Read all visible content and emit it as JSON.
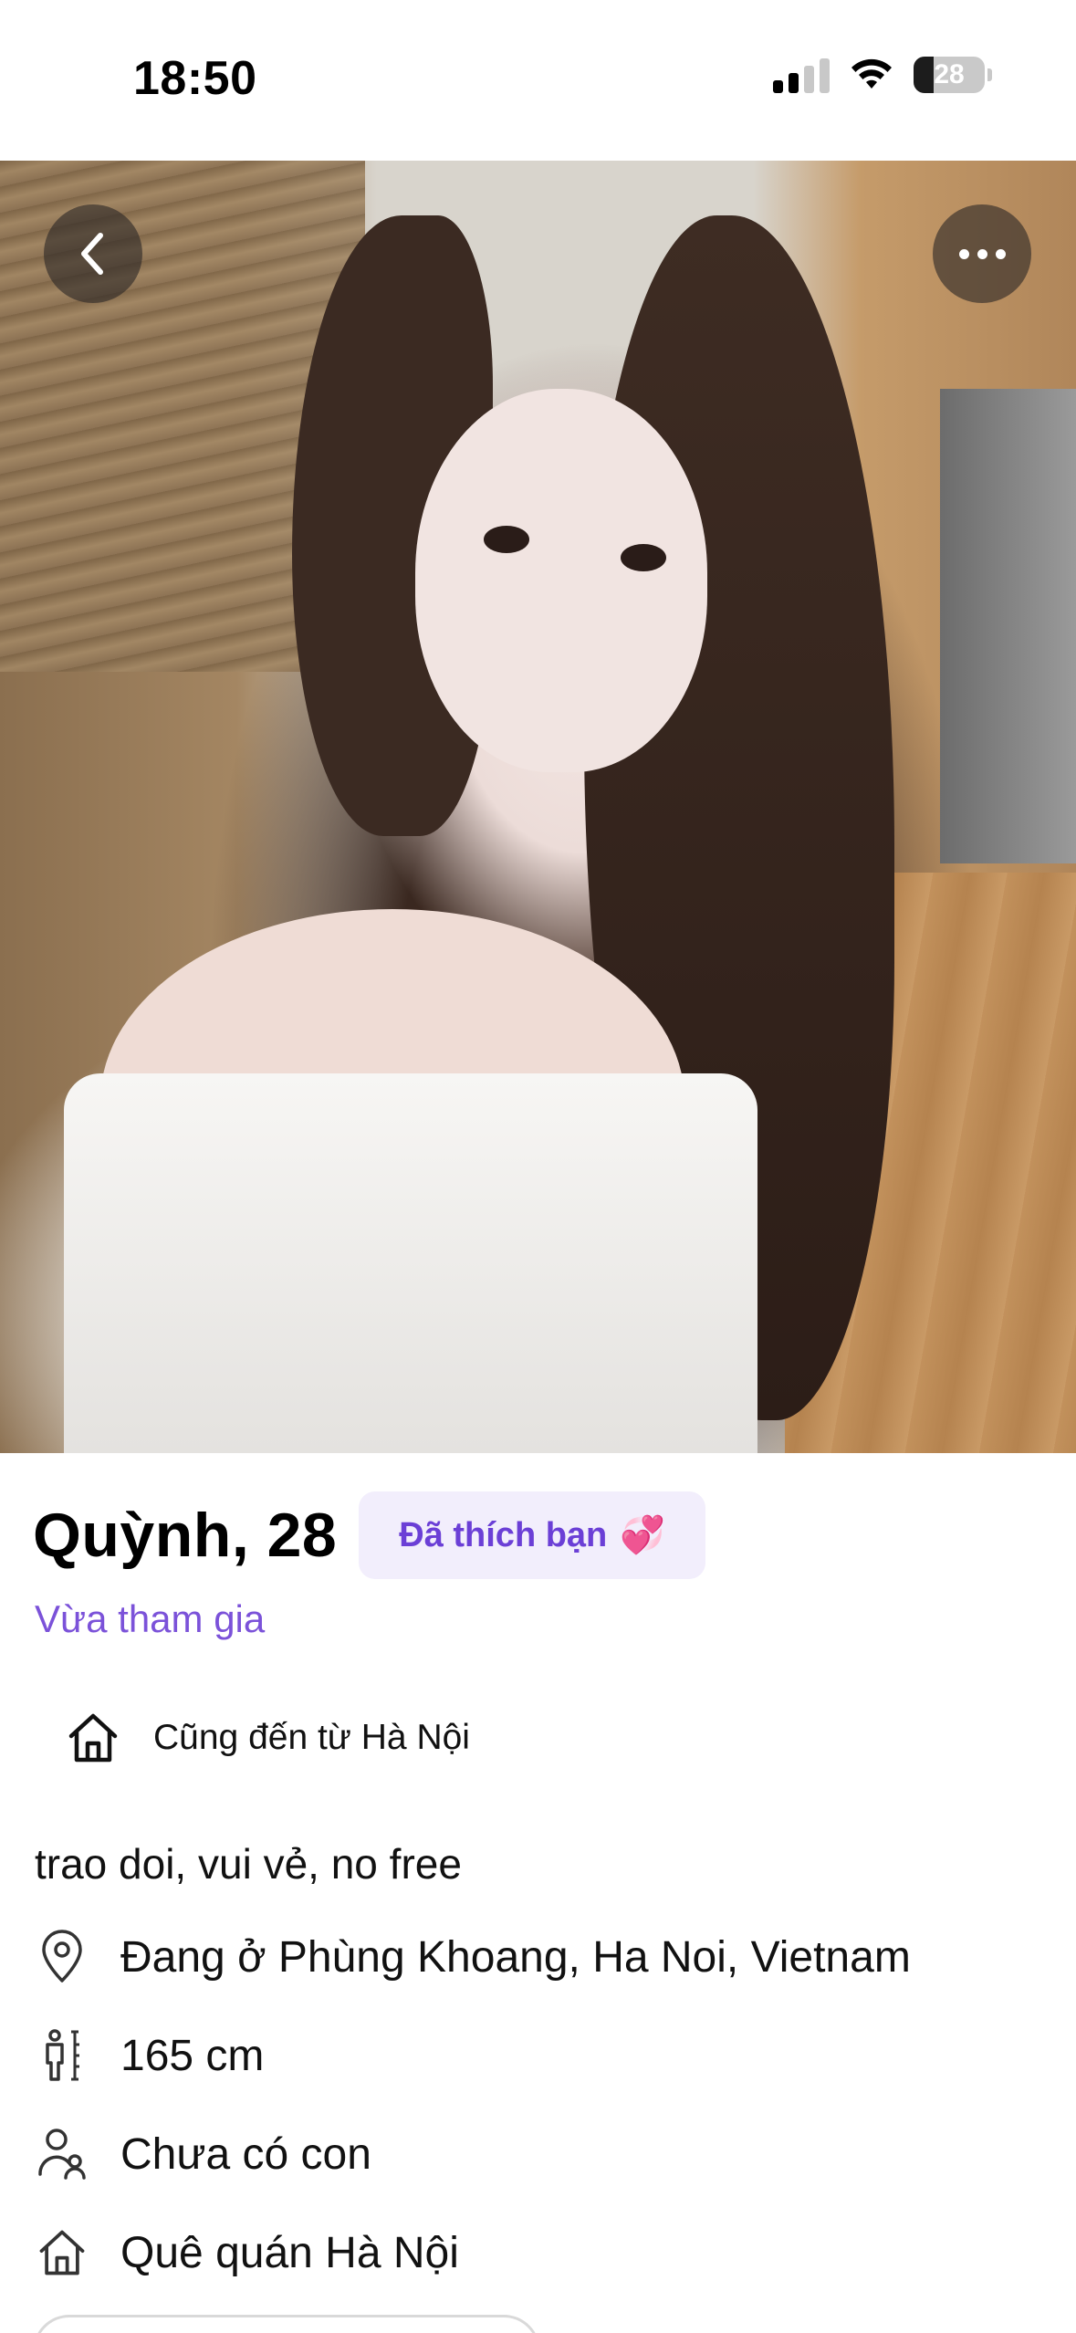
{
  "status_bar": {
    "time": "18:50",
    "battery_level": "28",
    "battery_fraction": 0.28,
    "icons": [
      "cellular-signal-icon",
      "wifi-icon",
      "battery-icon"
    ]
  },
  "photo": {
    "back_icon": "chevron-left-icon",
    "more_icon": "more-horizontal-icon"
  },
  "profile": {
    "name_age": "Quỳnh, 28",
    "liked_badge": "Đã thích bạn",
    "liked_emoji": "💞",
    "joined_status": "Vừa tham gia",
    "shared_origin": "Cũng đến từ Hà Nội",
    "bio": "trao doi, vui vẻ, no free",
    "details": [
      {
        "icon": "location-pin-icon",
        "text": "Đang ở Phùng Khoang, Ha Noi, Vietnam"
      },
      {
        "icon": "height-icon",
        "text": "165 cm"
      },
      {
        "icon": "children-icon",
        "text": "Chưa có con"
      },
      {
        "icon": "home-icon",
        "text": "Quê quán Hà Nội"
      }
    ]
  },
  "colors": {
    "accent_purple": "#7b52d9",
    "badge_background": "#f2eefc",
    "badge_text": "#6b3fd6"
  }
}
